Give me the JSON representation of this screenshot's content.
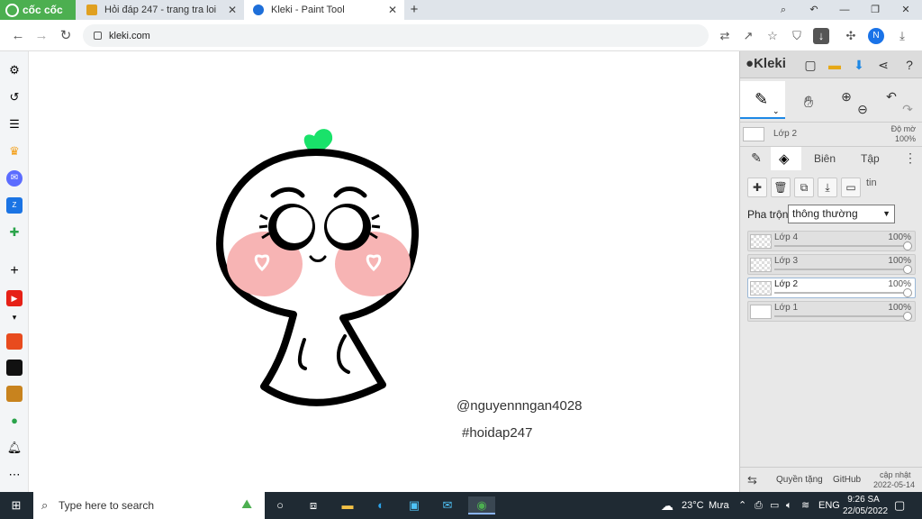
{
  "browser": {
    "brand": "cốc cốc",
    "tabs": [
      {
        "title": "Hỏi đáp 247 - trang tra loi",
        "close": "✕"
      },
      {
        "title": "Kleki - Paint Tool",
        "close": "✕"
      }
    ],
    "new_tab": "+",
    "url": "kleki.com",
    "profile_initial": "N"
  },
  "artwork": {
    "credit_handle": "@nguyennngan4028",
    "credit_tag": "#hoidap247"
  },
  "kleki": {
    "brand": "Kleki",
    "current_layer": "Lớp 2",
    "opacity_label": "Độ mờ",
    "opacity_value": "100%",
    "tabs": [
      "Biên",
      "Tập"
    ],
    "tab_extra": "tin",
    "blend_label": "Pha trộn",
    "blend_mode": "thông thường",
    "layers": [
      {
        "name": "Lớp 4",
        "opacity": "100%"
      },
      {
        "name": "Lớp 3",
        "opacity": "100%"
      },
      {
        "name": "Lớp 2",
        "opacity": "100%"
      },
      {
        "name": "Lớp 1",
        "opacity": "100%"
      }
    ],
    "footer": {
      "license": "Quyền tặng",
      "github": "GitHub",
      "update_label": "cập nhật",
      "update_date": "2022-05-14"
    }
  },
  "taskbar": {
    "search_placeholder": "Type here to search",
    "weather": "23°C",
    "weather_desc": "Mưa",
    "lang": "ENG",
    "time": "9:26 SA",
    "date": "22/05/2022"
  },
  "colors": {
    "kleki_accent": "#1e88e5",
    "coccoc_green": "#4caf50",
    "heart_green": "#19e26a",
    "blush_pink": "#f7b4b4"
  }
}
